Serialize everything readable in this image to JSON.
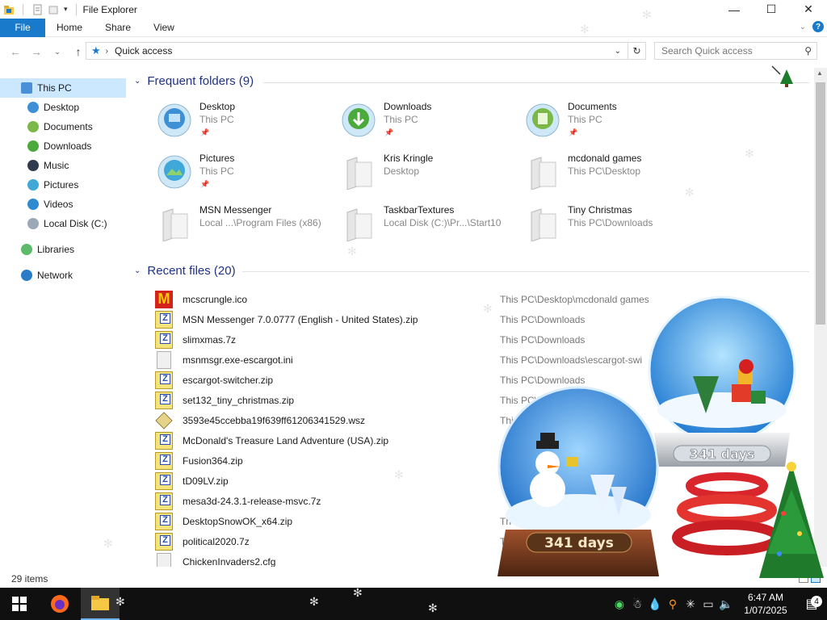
{
  "window": {
    "title": "File Explorer",
    "controls": {
      "minimize": "—",
      "maximize": "☐",
      "close": "✕"
    }
  },
  "ribbon": {
    "file": "File",
    "tabs": [
      "Home",
      "Share",
      "View"
    ],
    "help": "?"
  },
  "navigation": {
    "path": "Quick access",
    "search_placeholder": "Search Quick access"
  },
  "sidebar": {
    "items": [
      {
        "label": "This PC",
        "icon": "computer-icon",
        "selected": true
      },
      {
        "label": "Desktop",
        "icon": "desktop-icon"
      },
      {
        "label": "Documents",
        "icon": "documents-icon"
      },
      {
        "label": "Downloads",
        "icon": "downloads-icon"
      },
      {
        "label": "Music",
        "icon": "music-icon"
      },
      {
        "label": "Pictures",
        "icon": "pictures-icon"
      },
      {
        "label": "Videos",
        "icon": "videos-icon"
      },
      {
        "label": "Local Disk (C:)",
        "icon": "disk-icon"
      },
      {
        "label": "Libraries",
        "icon": "libraries-icon"
      },
      {
        "label": "Network",
        "icon": "network-icon"
      }
    ]
  },
  "frequent": {
    "header": "Frequent folders (9)",
    "folders": [
      {
        "name": "Desktop",
        "path": "This PC",
        "icon": "desktop-folder-icon",
        "pinned": true
      },
      {
        "name": "Downloads",
        "path": "This PC",
        "icon": "downloads-folder-icon",
        "pinned": true
      },
      {
        "name": "Documents",
        "path": "This PC",
        "icon": "documents-folder-icon",
        "pinned": true
      },
      {
        "name": "Pictures",
        "path": "This PC",
        "icon": "pictures-folder-icon",
        "pinned": true
      },
      {
        "name": "Kris Kringle",
        "path": "Desktop",
        "icon": "folder-icon",
        "pinned": false
      },
      {
        "name": "mcdonald games",
        "path": "This PC\\Desktop",
        "icon": "folder-icon",
        "pinned": false
      },
      {
        "name": "MSN Messenger",
        "path": "Local ...\\Program Files (x86)",
        "icon": "folder-icon",
        "pinned": false
      },
      {
        "name": "TaskbarTextures",
        "path": "Local Disk (C:)\\Pr...\\Start10",
        "icon": "folder-icon",
        "pinned": false
      },
      {
        "name": "Tiny Christmas",
        "path": "This PC\\Downloads",
        "icon": "folder-icon",
        "pinned": false
      }
    ],
    "pin_glyph": "📌"
  },
  "recent": {
    "header": "Recent files (20)",
    "files": [
      {
        "name": "mcscrungle.ico",
        "path": "This PC\\Desktop\\mcdonald games",
        "type": "mc"
      },
      {
        "name": "MSN Messenger 7.0.0777 (English - United States).zip",
        "path": "This PC\\Downloads",
        "type": "zip"
      },
      {
        "name": "slimxmas.7z",
        "path": "This PC\\Downloads",
        "type": "zip"
      },
      {
        "name": "msnmsgr.exe-escargot.ini",
        "path": "This PC\\Downloads\\escargot-swi",
        "type": "doc"
      },
      {
        "name": "escargot-switcher.zip",
        "path": "This PC\\Downloads",
        "type": "zip"
      },
      {
        "name": "set132_tiny_christmas.zip",
        "path": "This PC\\D",
        "type": "zip"
      },
      {
        "name": "3593e45ccebba19f639ff61206341529.wsz",
        "path": "Thi",
        "type": "wsz"
      },
      {
        "name": "McDonald's Treasure Land Adventure (USA).zip",
        "path": "",
        "type": "zip"
      },
      {
        "name": "Fusion364.zip",
        "path": "",
        "type": "zip"
      },
      {
        "name": "tD09LV.zip",
        "path": "",
        "type": "zip"
      },
      {
        "name": "mesa3d-24.3.1-release-msvc.7z",
        "path": "",
        "type": "zip"
      },
      {
        "name": "DesktopSnowOK_x64.zip",
        "path": "Th",
        "type": "zip"
      },
      {
        "name": "political2020.7z",
        "path": "Th",
        "type": "zip"
      },
      {
        "name": "ChickenInvaders2.cfg",
        "path": "",
        "type": "doc"
      }
    ]
  },
  "status": {
    "items": "29 items"
  },
  "taskbar": {
    "clock_time": "6:47 AM",
    "clock_date": "1/07/2025",
    "notifications": "4"
  },
  "decorations": {
    "globe_left_label": "341 days",
    "globe_right_label": "341 days"
  },
  "colors": {
    "accent": "#1979ca",
    "header_blue": "#1e3287",
    "selection": "#cce8ff",
    "taskbar": "#101010"
  }
}
